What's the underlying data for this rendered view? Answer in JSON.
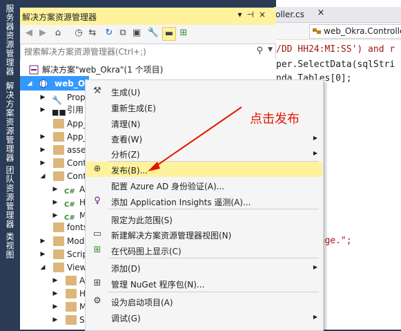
{
  "dock": {
    "tabs": [
      "服务器资源管理器",
      "解决方案资源管理器",
      "团队资源管理器",
      "类视图"
    ]
  },
  "editor": {
    "doc_tab": "oller.cs",
    "nav_dropdown": "web_Okra.Controlle",
    "code_lines": [
      "/DD HH24:MI:SS') and r",
      "per.SelectData(sqlStri",
      "nda.Tables[0];",
      "Report page.\";",
      "\";"
    ]
  },
  "solution_explorer": {
    "title": "解决方案资源管理器",
    "search_placeholder": "搜索解决方案资源管理器(Ctrl+;)",
    "tree": [
      {
        "label": "解决方案\"web_Okra\"(1 个项目)"
      },
      {
        "label": "web_Okra"
      },
      {
        "label": "Prop"
      },
      {
        "label": "引用"
      },
      {
        "label": "App_"
      },
      {
        "label": "App_"
      },
      {
        "label": "asse"
      },
      {
        "label": "Cont"
      },
      {
        "label": "Contr"
      },
      {
        "label": "A"
      },
      {
        "label": "H"
      },
      {
        "label": "M"
      },
      {
        "label": "fonts"
      },
      {
        "label": "Mod"
      },
      {
        "label": "Scrip"
      },
      {
        "label": "View"
      },
      {
        "label": "A"
      },
      {
        "label": "H"
      },
      {
        "label": "M"
      },
      {
        "label": "S"
      }
    ]
  },
  "context_menu": {
    "items": [
      {
        "label": "生成(U)",
        "icon": "build-icon"
      },
      {
        "label": "重新生成(E)",
        "icon": ""
      },
      {
        "label": "清理(N)",
        "icon": ""
      },
      {
        "label": "查看(W)",
        "icon": "",
        "submenu": true
      },
      {
        "label": "分析(Z)",
        "icon": "",
        "submenu": true
      },
      {
        "label": "发布(B)...",
        "icon": "publish-globe-icon",
        "highlighted": true
      },
      {
        "label": "配置 Azure AD 身份验证(A)...",
        "icon": ""
      },
      {
        "label": "添加 Application Insights 遥测(A)...",
        "icon": "app-insights-icon"
      },
      {
        "label": "限定为此范围(S)",
        "icon": ""
      },
      {
        "label": "新建解决方案资源管理器视图(N)",
        "icon": "new-view-icon"
      },
      {
        "label": "在代码图上显示(C)",
        "icon": "code-map-icon"
      },
      {
        "label": "添加(D)",
        "icon": "",
        "submenu": true
      },
      {
        "label": "管理 NuGet 程序包(N)...",
        "icon": "nuget-icon"
      },
      {
        "label": "设为启动项目(A)",
        "icon": "gear-icon"
      },
      {
        "label": "调试(G)",
        "icon": "",
        "submenu": true
      }
    ]
  },
  "annotation": {
    "text": "点击发布",
    "color": "#e51400"
  },
  "colors": {
    "title_active": "#fff29d",
    "selection": "#3399ff",
    "dock": "#2b3a55"
  }
}
